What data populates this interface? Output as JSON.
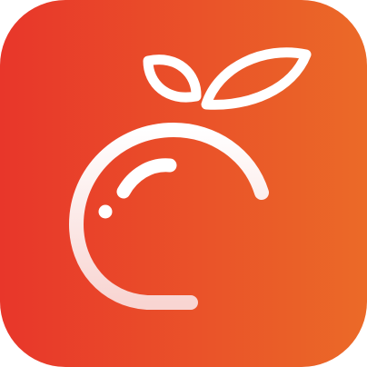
{
  "icon": {
    "name": "orange-fruit-app-icon",
    "colors": {
      "gradient_start": "#E8362A",
      "gradient_end": "#EB6A28",
      "glyph_start": "#FFFFFF",
      "glyph_end": "#F8D5D2"
    }
  }
}
